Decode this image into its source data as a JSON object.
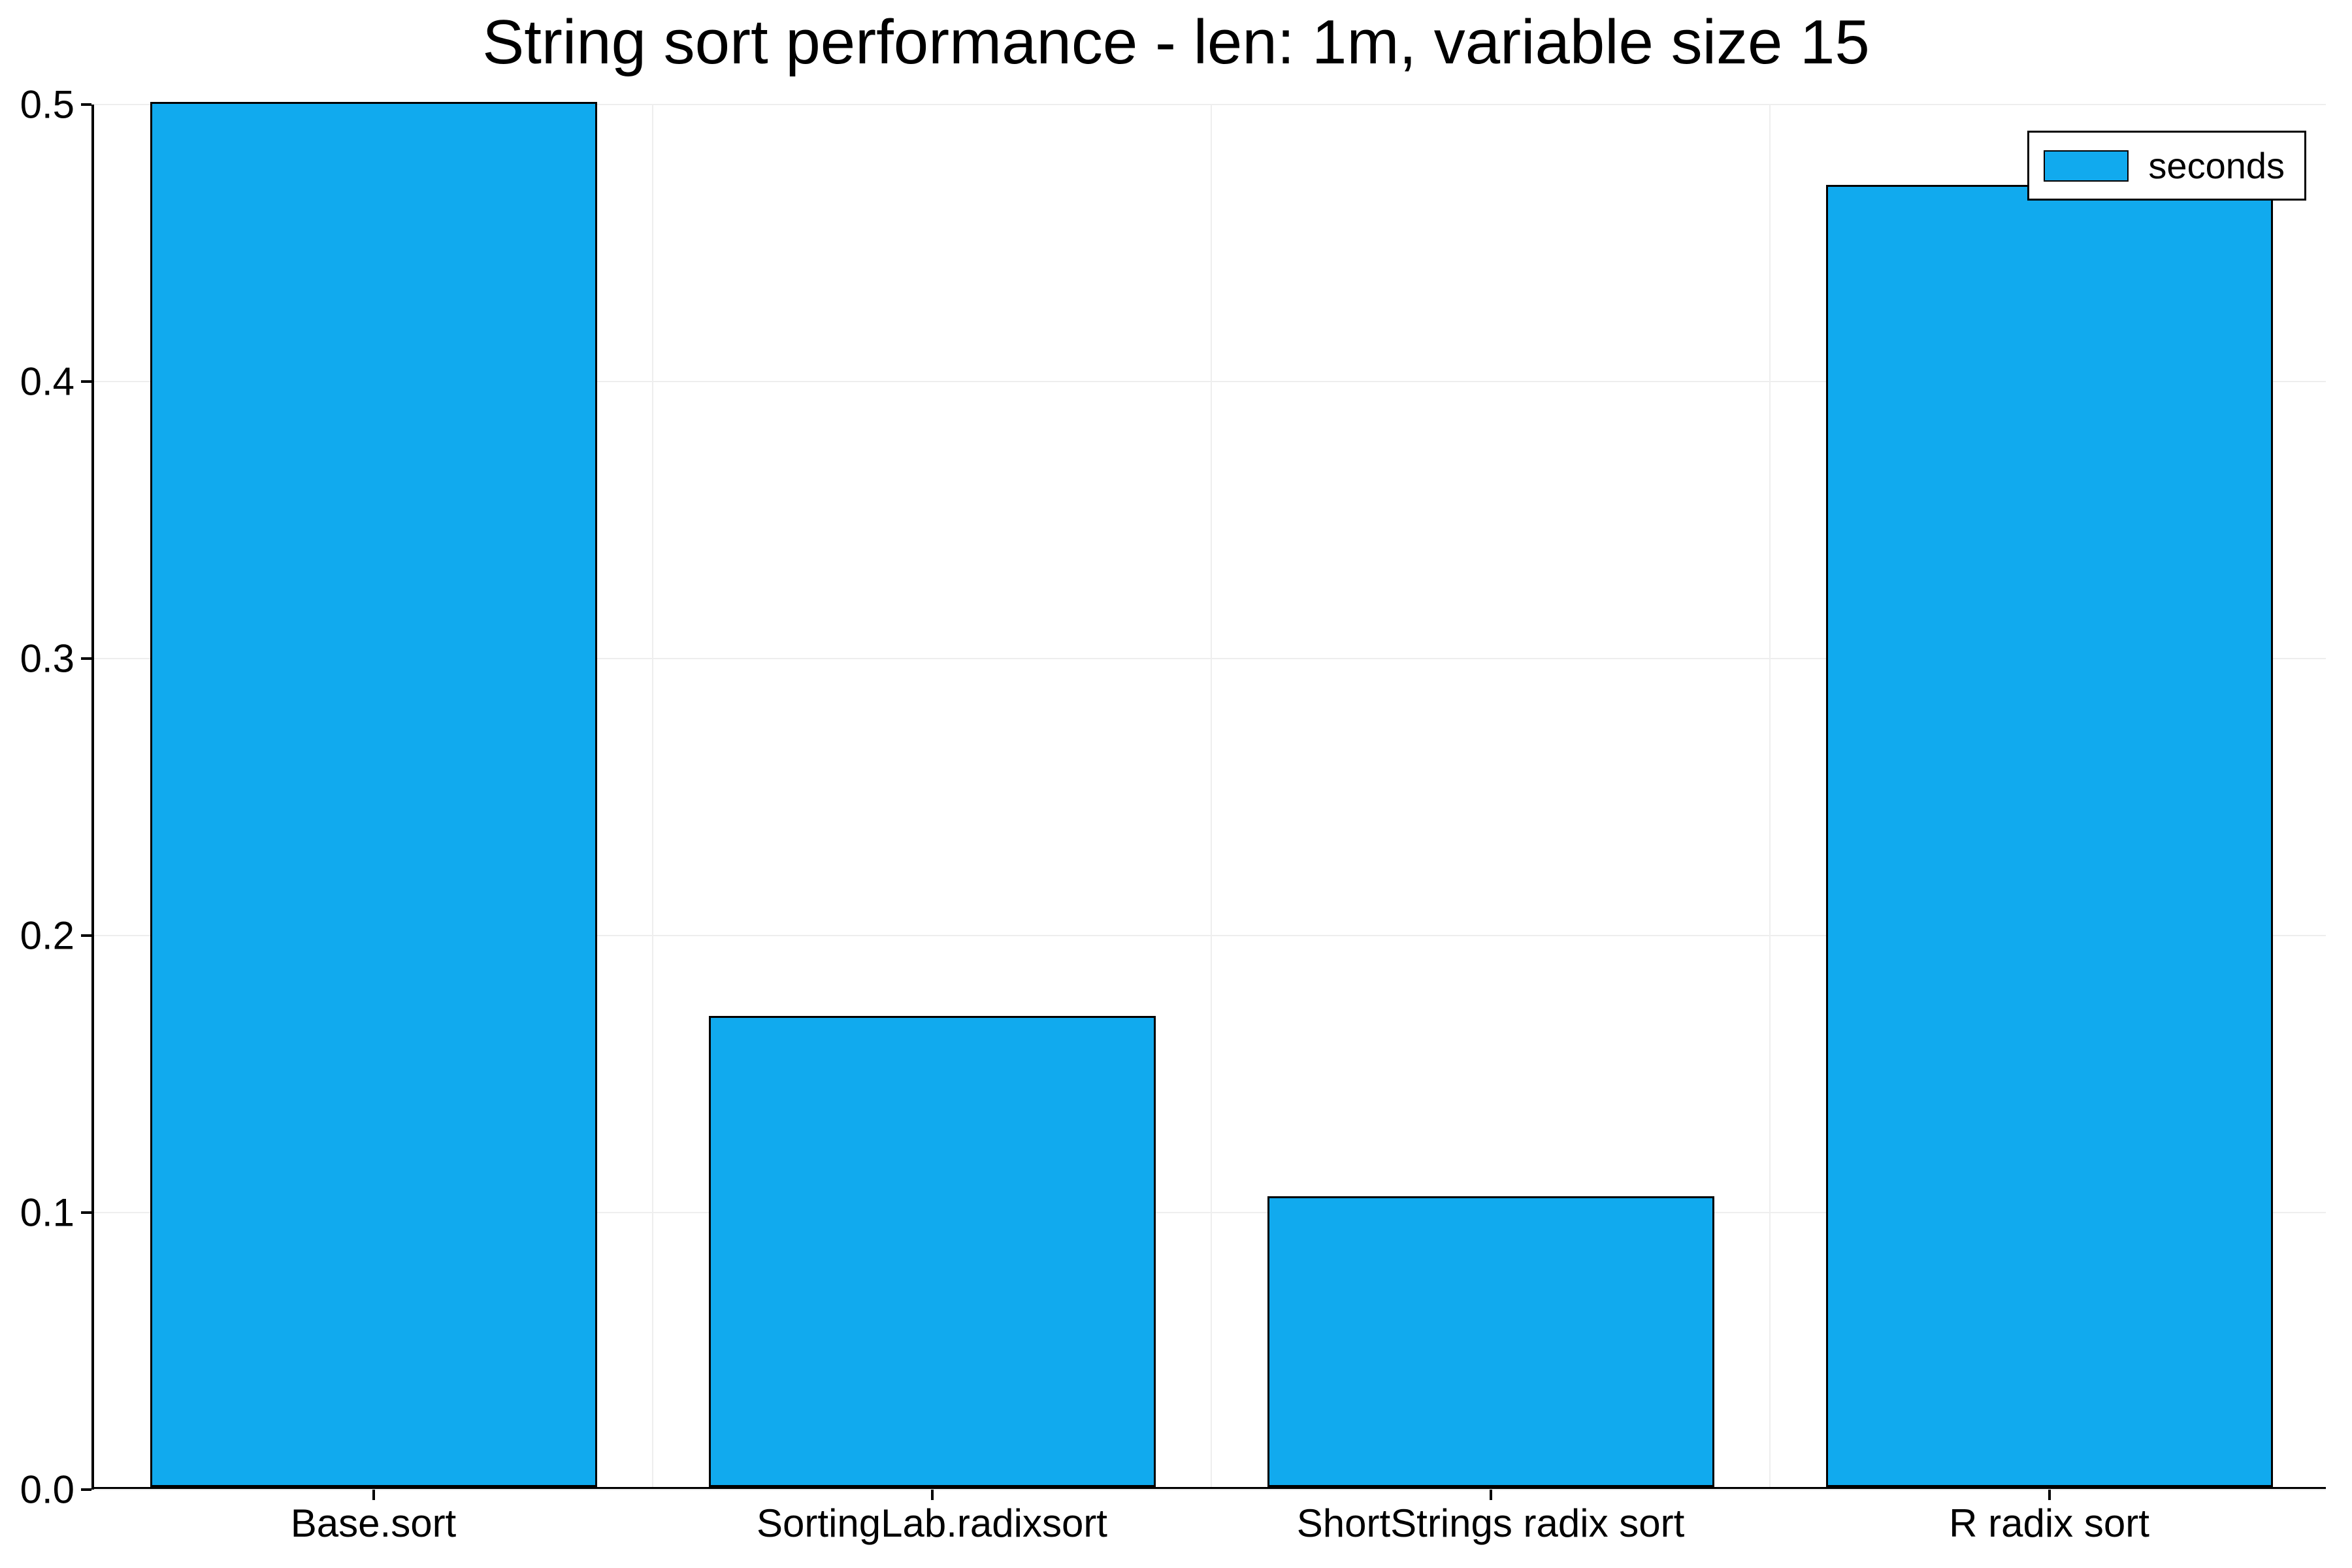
{
  "chart_data": {
    "type": "bar",
    "title": "String sort performance - len: 1m, variable size 15",
    "categories": [
      "Base.sort",
      "SortingLab.radixsort",
      "ShortStrings radix sort",
      "R radix sort"
    ],
    "values": [
      0.5,
      0.17,
      0.105,
      0.47
    ],
    "series_name": "seconds",
    "xlabel": "",
    "ylabel": "",
    "ylim": [
      0.0,
      0.5
    ],
    "yticks": [
      0.0,
      0.1,
      0.2,
      0.3,
      0.4,
      0.5
    ],
    "ytick_labels": [
      "0.0",
      "0.1",
      "0.2",
      "0.3",
      "0.4",
      "0.5"
    ],
    "grid": true,
    "legend_position": "top-right",
    "bar_color": "#11aaee"
  }
}
